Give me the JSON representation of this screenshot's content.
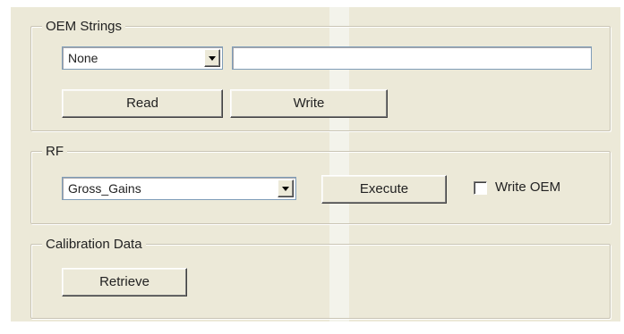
{
  "oem_strings": {
    "title": "OEM Strings",
    "selector_value": "None",
    "text_value": "",
    "read_label": "Read",
    "write_label": "Write"
  },
  "rf": {
    "title": "RF",
    "selector_value": "Gross_Gains",
    "execute_label": "Execute",
    "write_oem_label": "Write OEM",
    "write_oem_checked": false
  },
  "calibration": {
    "title": "Calibration Data",
    "retrieve_label": "Retrieve"
  },
  "colors": {
    "panel_bg": "#ece9d8",
    "input_border": "#7f9db9"
  },
  "icons": {
    "dropdown_arrow": "chevron-down-icon"
  }
}
